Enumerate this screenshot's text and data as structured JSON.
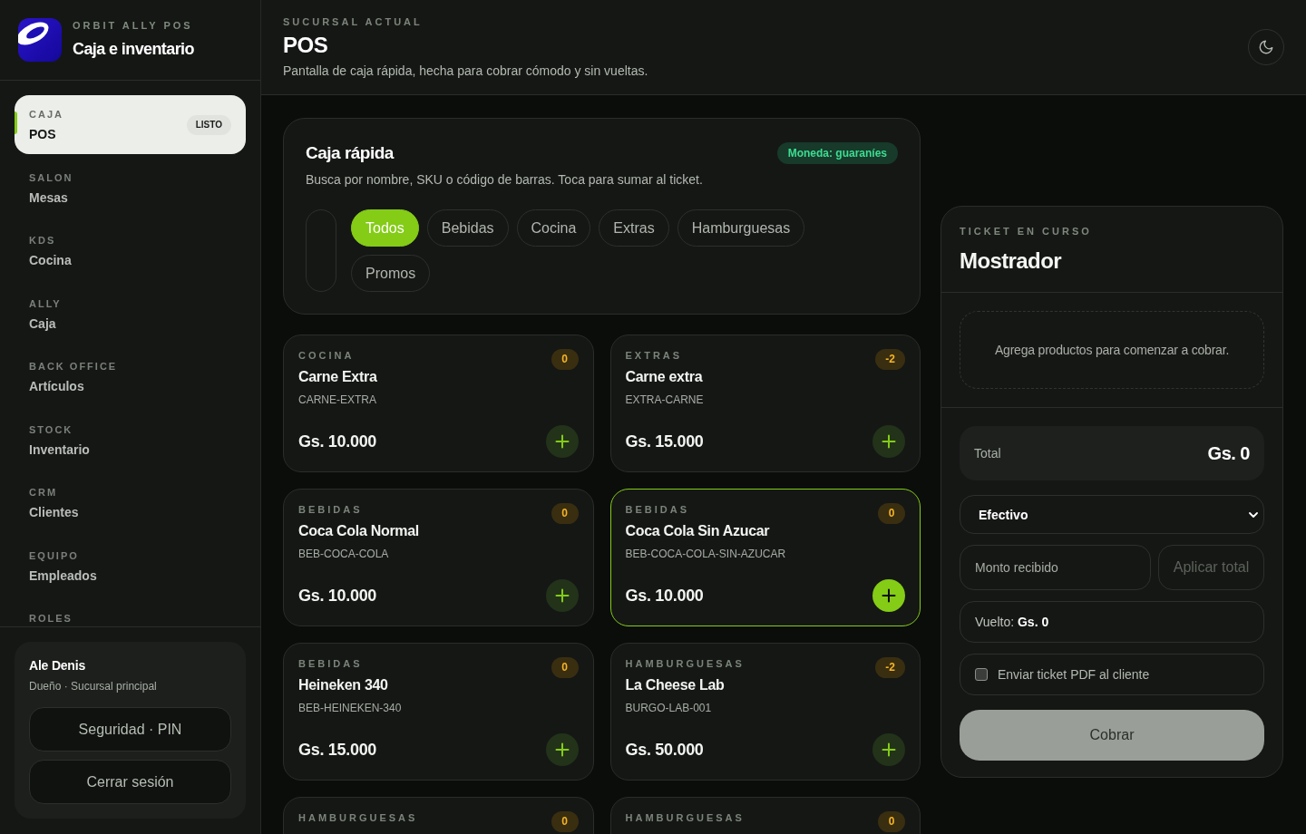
{
  "sidebar": {
    "brand": {
      "eyebrow": "ORBIT ALLY POS",
      "title": "Caja e inventario"
    },
    "nav": [
      {
        "section": "CAJA",
        "label": "POS",
        "badge": "LISTO",
        "selected": true
      },
      {
        "section": "SALON",
        "label": "Mesas",
        "selected": false
      },
      {
        "section": "KDS",
        "label": "Cocina",
        "selected": false
      },
      {
        "section": "ALLY",
        "label": "Caja",
        "selected": false
      },
      {
        "section": "BACK OFFICE",
        "label": "Artículos",
        "selected": false
      },
      {
        "section": "STOCK",
        "label": "Inventario",
        "selected": false
      },
      {
        "section": "CRM",
        "label": "Clientes",
        "selected": false
      },
      {
        "section": "EQUIPO",
        "label": "Empleados",
        "selected": false
      },
      {
        "section": "ROLES",
        "selected": false
      }
    ],
    "user": {
      "name": "Ale Denis",
      "role": "Dueño · Sucursal principal",
      "buttons": [
        "Seguridad · PIN",
        "Cerrar sesión"
      ]
    }
  },
  "header": {
    "eyebrow": "SUCURSAL ACTUAL",
    "title": "POS",
    "subtitle": "Pantalla de caja rápida, hecha para cobrar cómodo y sin vueltas."
  },
  "quick_checkout": {
    "title": "Caja rápida",
    "badge": "Moneda: guaraníes",
    "subtitle": "Busca por nombre, SKU o código de barras. Toca para sumar al ticket.",
    "categories": [
      {
        "label": "Todos",
        "selected": true
      },
      {
        "label": "Bebidas",
        "selected": false
      },
      {
        "label": "Cocina",
        "selected": false
      },
      {
        "label": "Extras",
        "selected": false
      },
      {
        "label": "Hamburguesas",
        "selected": false
      },
      {
        "label": "Promos",
        "selected": false
      }
    ]
  },
  "products": [
    {
      "category": "COCINA",
      "name": "Carne Extra",
      "sku": "CARNE-EXTRA",
      "price": "Gs. 10.000",
      "stock": "0",
      "selected": false
    },
    {
      "category": "EXTRAS",
      "name": "Carne extra",
      "sku": "EXTRA-CARNE",
      "price": "Gs. 15.000",
      "stock": "-2",
      "selected": false
    },
    {
      "category": "BEBIDAS",
      "name": "Coca Cola Normal",
      "sku": "BEB-COCA-COLA",
      "price": "Gs. 10.000",
      "stock": "0",
      "selected": false
    },
    {
      "category": "BEBIDAS",
      "name": "Coca Cola Sin Azucar",
      "sku": "BEB-COCA-COLA-SIN-AZUCAR",
      "price": "Gs. 10.000",
      "stock": "0",
      "selected": true
    },
    {
      "category": "BEBIDAS",
      "name": "Heineken 340",
      "sku": "BEB-HEINEKEN-340",
      "price": "Gs. 15.000",
      "stock": "0",
      "selected": false
    },
    {
      "category": "HAMBURGUESAS",
      "name": "La Cheese Lab",
      "sku": "BURGO-LAB-001",
      "price": "Gs. 50.000",
      "stock": "-2",
      "selected": false
    },
    {
      "category": "HAMBURGUESAS",
      "stock": "0",
      "selected": false
    },
    {
      "category": "HAMBURGUESAS",
      "stock": "0",
      "selected": false
    }
  ],
  "ticket": {
    "eyebrow": "TICKET EN CURSO",
    "title": "Mostrador",
    "empty_message": "Agrega productos para comenzar a cobrar.",
    "total": {
      "label": "Total",
      "value": "Gs. 0"
    },
    "payment_method": {
      "value": "Efectivo"
    },
    "amount_received": {
      "placeholder": "Monto recibido"
    },
    "apply_total": {
      "label": "Aplicar total",
      "disabled": true
    },
    "change": "Vuelto: **Gs. 0**",
    "send_pdf": {
      "label": "Enviar ticket PDF al cliente",
      "checked": false
    },
    "charge": {
      "label": "Cobrar",
      "disabled": true
    }
  }
}
